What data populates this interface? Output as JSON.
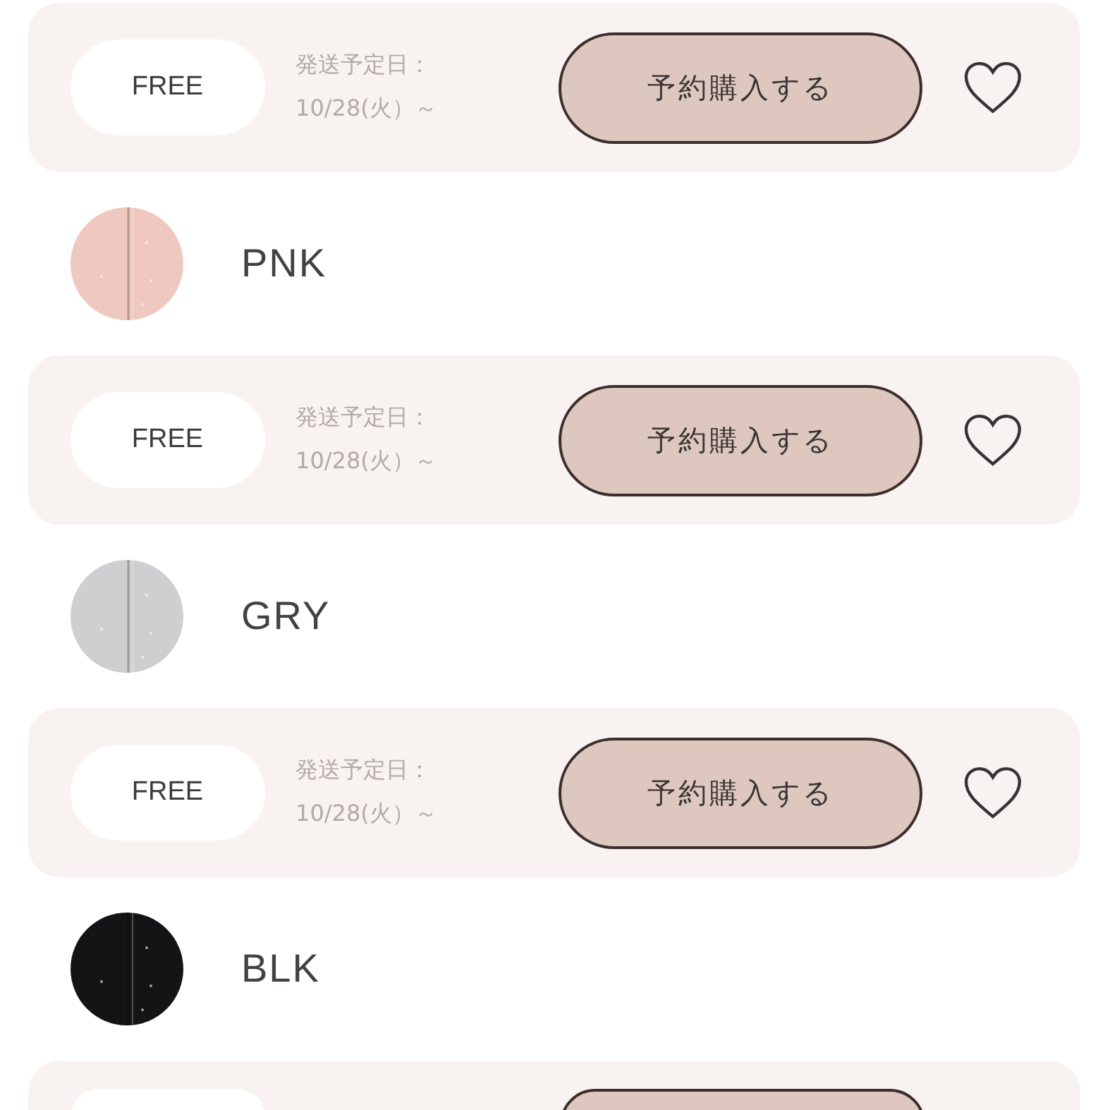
{
  "items": [
    {
      "kind": "size",
      "size": "FREE",
      "ship_label": "発送予定日：",
      "ship_date": "10/28(火）～",
      "button": "予約購入する",
      "favorited": false
    },
    {
      "kind": "color",
      "name": "PNK",
      "color": "#efc9bf"
    },
    {
      "kind": "size",
      "size": "FREE",
      "ship_label": "発送予定日：",
      "ship_date": "10/28(火）～",
      "button": "予約購入する",
      "favorited": false
    },
    {
      "kind": "color",
      "name": "GRY",
      "color": "#cfcfd1"
    },
    {
      "kind": "size",
      "size": "FREE",
      "ship_label": "発送予定日：",
      "ship_date": "10/28(火）～",
      "button": "予約購入する",
      "favorited": false
    },
    {
      "kind": "color",
      "name": "BLK",
      "color": "#141316"
    },
    {
      "kind": "size_cut"
    }
  ]
}
